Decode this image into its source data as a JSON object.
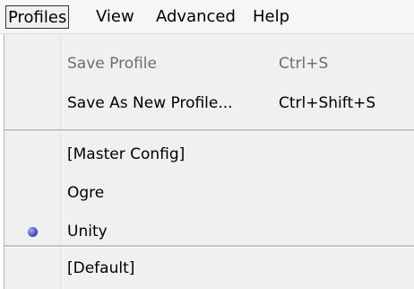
{
  "menubar": {
    "items": [
      {
        "label": "Profiles"
      },
      {
        "label": "View"
      },
      {
        "label": "Advanced"
      },
      {
        "label": "Help"
      }
    ]
  },
  "dropdown": {
    "items": [
      {
        "label": "Save Profile",
        "shortcut": "Ctrl+S",
        "enabled": false
      },
      {
        "label": "Save As New Profile...",
        "shortcut": "Ctrl+Shift+S",
        "enabled": true
      },
      {
        "label": "[Master Config]",
        "checked": false
      },
      {
        "label": "Ogre",
        "checked": false
      },
      {
        "label": "Unity",
        "checked": true
      },
      {
        "label": "[Default]",
        "checked": false
      }
    ]
  },
  "colors": {
    "radio_accent": "#4a55c8",
    "menu_background": "#f0f0f0",
    "disabled_text": "#6d6d6d"
  }
}
